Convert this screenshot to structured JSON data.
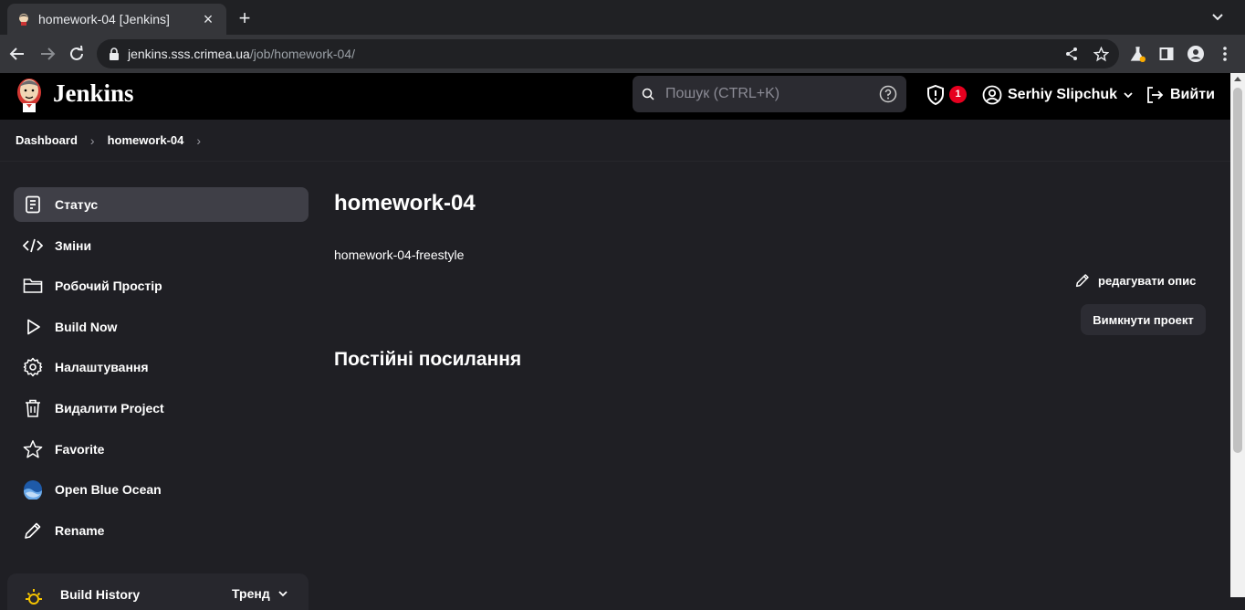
{
  "browser": {
    "tab_title": "homework-04 [Jenkins]",
    "tab_close": "×",
    "new_tab": "+",
    "url_host": "jenkins.sss.crimea.ua",
    "url_path": "/job/homework-04/"
  },
  "header": {
    "brand": "Jenkins",
    "search_placeholder": "Пошук (CTRL+K)",
    "security_count": "1",
    "user_name": "Serhiy Slipchuk",
    "logout_label": "Вийти"
  },
  "breadcrumbs": [
    "Dashboard",
    "homework-04"
  ],
  "sidebar": {
    "items": [
      {
        "label": "Статус",
        "icon": "status-icon"
      },
      {
        "label": "Зміни",
        "icon": "code-icon"
      },
      {
        "label": "Робочий Простір",
        "icon": "folder-icon"
      },
      {
        "label": "Build Now",
        "icon": "play-icon"
      },
      {
        "label": "Налаштування",
        "icon": "gear-icon"
      },
      {
        "label": "Видалити Project",
        "icon": "trash-icon"
      },
      {
        "label": "Favorite",
        "icon": "star-icon"
      },
      {
        "label": "Open Blue Ocean",
        "icon": "blue-ocean-icon"
      },
      {
        "label": "Rename",
        "icon": "pencil-icon"
      }
    ]
  },
  "build_history": {
    "title": "Build History",
    "trend": "Тренд"
  },
  "main": {
    "title": "homework-04",
    "description": "homework-04-freestyle",
    "edit_description": "редагувати опис",
    "disable_project": "Вимкнути проект",
    "permalinks_title": "Постійні посилання"
  },
  "colors": {
    "header_bg": "#000000",
    "page_bg": "#1f1f24",
    "active_item_bg": "#3f3f47",
    "badge_red": "#e6001f"
  }
}
